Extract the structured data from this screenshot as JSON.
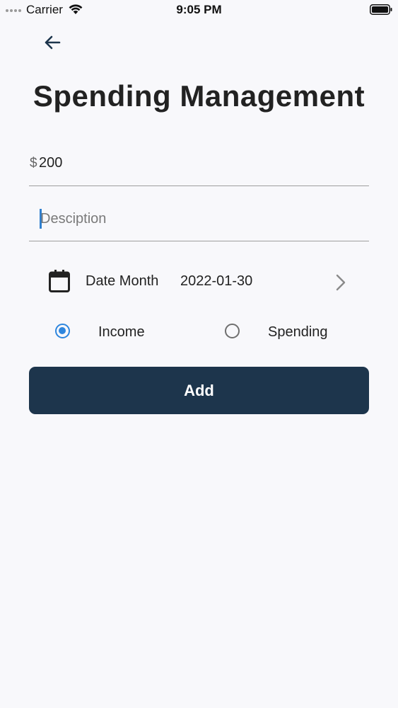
{
  "status_bar": {
    "carrier": "Carrier",
    "time": "9:05 PM"
  },
  "page": {
    "title": "Spending Management"
  },
  "form": {
    "currency_prefix": "$",
    "amount_value": "200",
    "description_value": "",
    "description_placeholder": "Desciption",
    "date_label": "Date Month",
    "date_value": "2022-01-30",
    "type_options": [
      {
        "label": "Income",
        "selected": true
      },
      {
        "label": "Spending",
        "selected": false
      }
    ],
    "submit_label": "Add"
  },
  "colors": {
    "primary": "#1d354c",
    "radio_selected": "#2e86de",
    "background": "#f8f8fb"
  },
  "icons": {
    "back": "arrow-left-icon",
    "calendar": "calendar-icon",
    "chevron": "chevron-right-icon",
    "wifi": "wifi-icon",
    "battery": "battery-icon"
  }
}
